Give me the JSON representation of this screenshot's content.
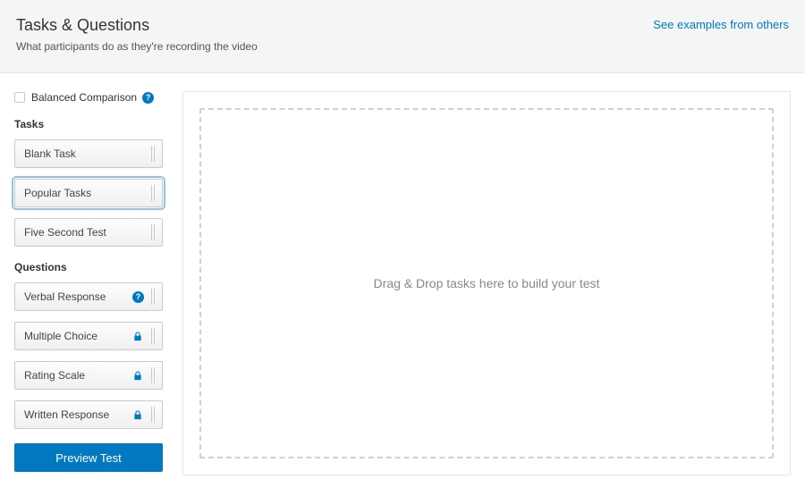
{
  "header": {
    "title": "Tasks & Questions",
    "subtitle": "What participants do as they're recording the video",
    "examples_link": "See examples from others"
  },
  "sidebar": {
    "balanced_label": "Balanced Comparison",
    "tasks_label": "Tasks",
    "questions_label": "Questions",
    "tasks": [
      {
        "label": "Blank Task",
        "active": false
      },
      {
        "label": "Popular Tasks",
        "active": true
      },
      {
        "label": "Five Second Test",
        "active": false
      }
    ],
    "questions": [
      {
        "label": "Verbal Response",
        "icon": "help"
      },
      {
        "label": "Multiple Choice",
        "icon": "lock"
      },
      {
        "label": "Rating Scale",
        "icon": "lock"
      },
      {
        "label": "Written Response",
        "icon": "lock"
      }
    ],
    "preview_label": "Preview Test"
  },
  "main": {
    "drop_hint": "Drag & Drop tasks here to build your test"
  }
}
